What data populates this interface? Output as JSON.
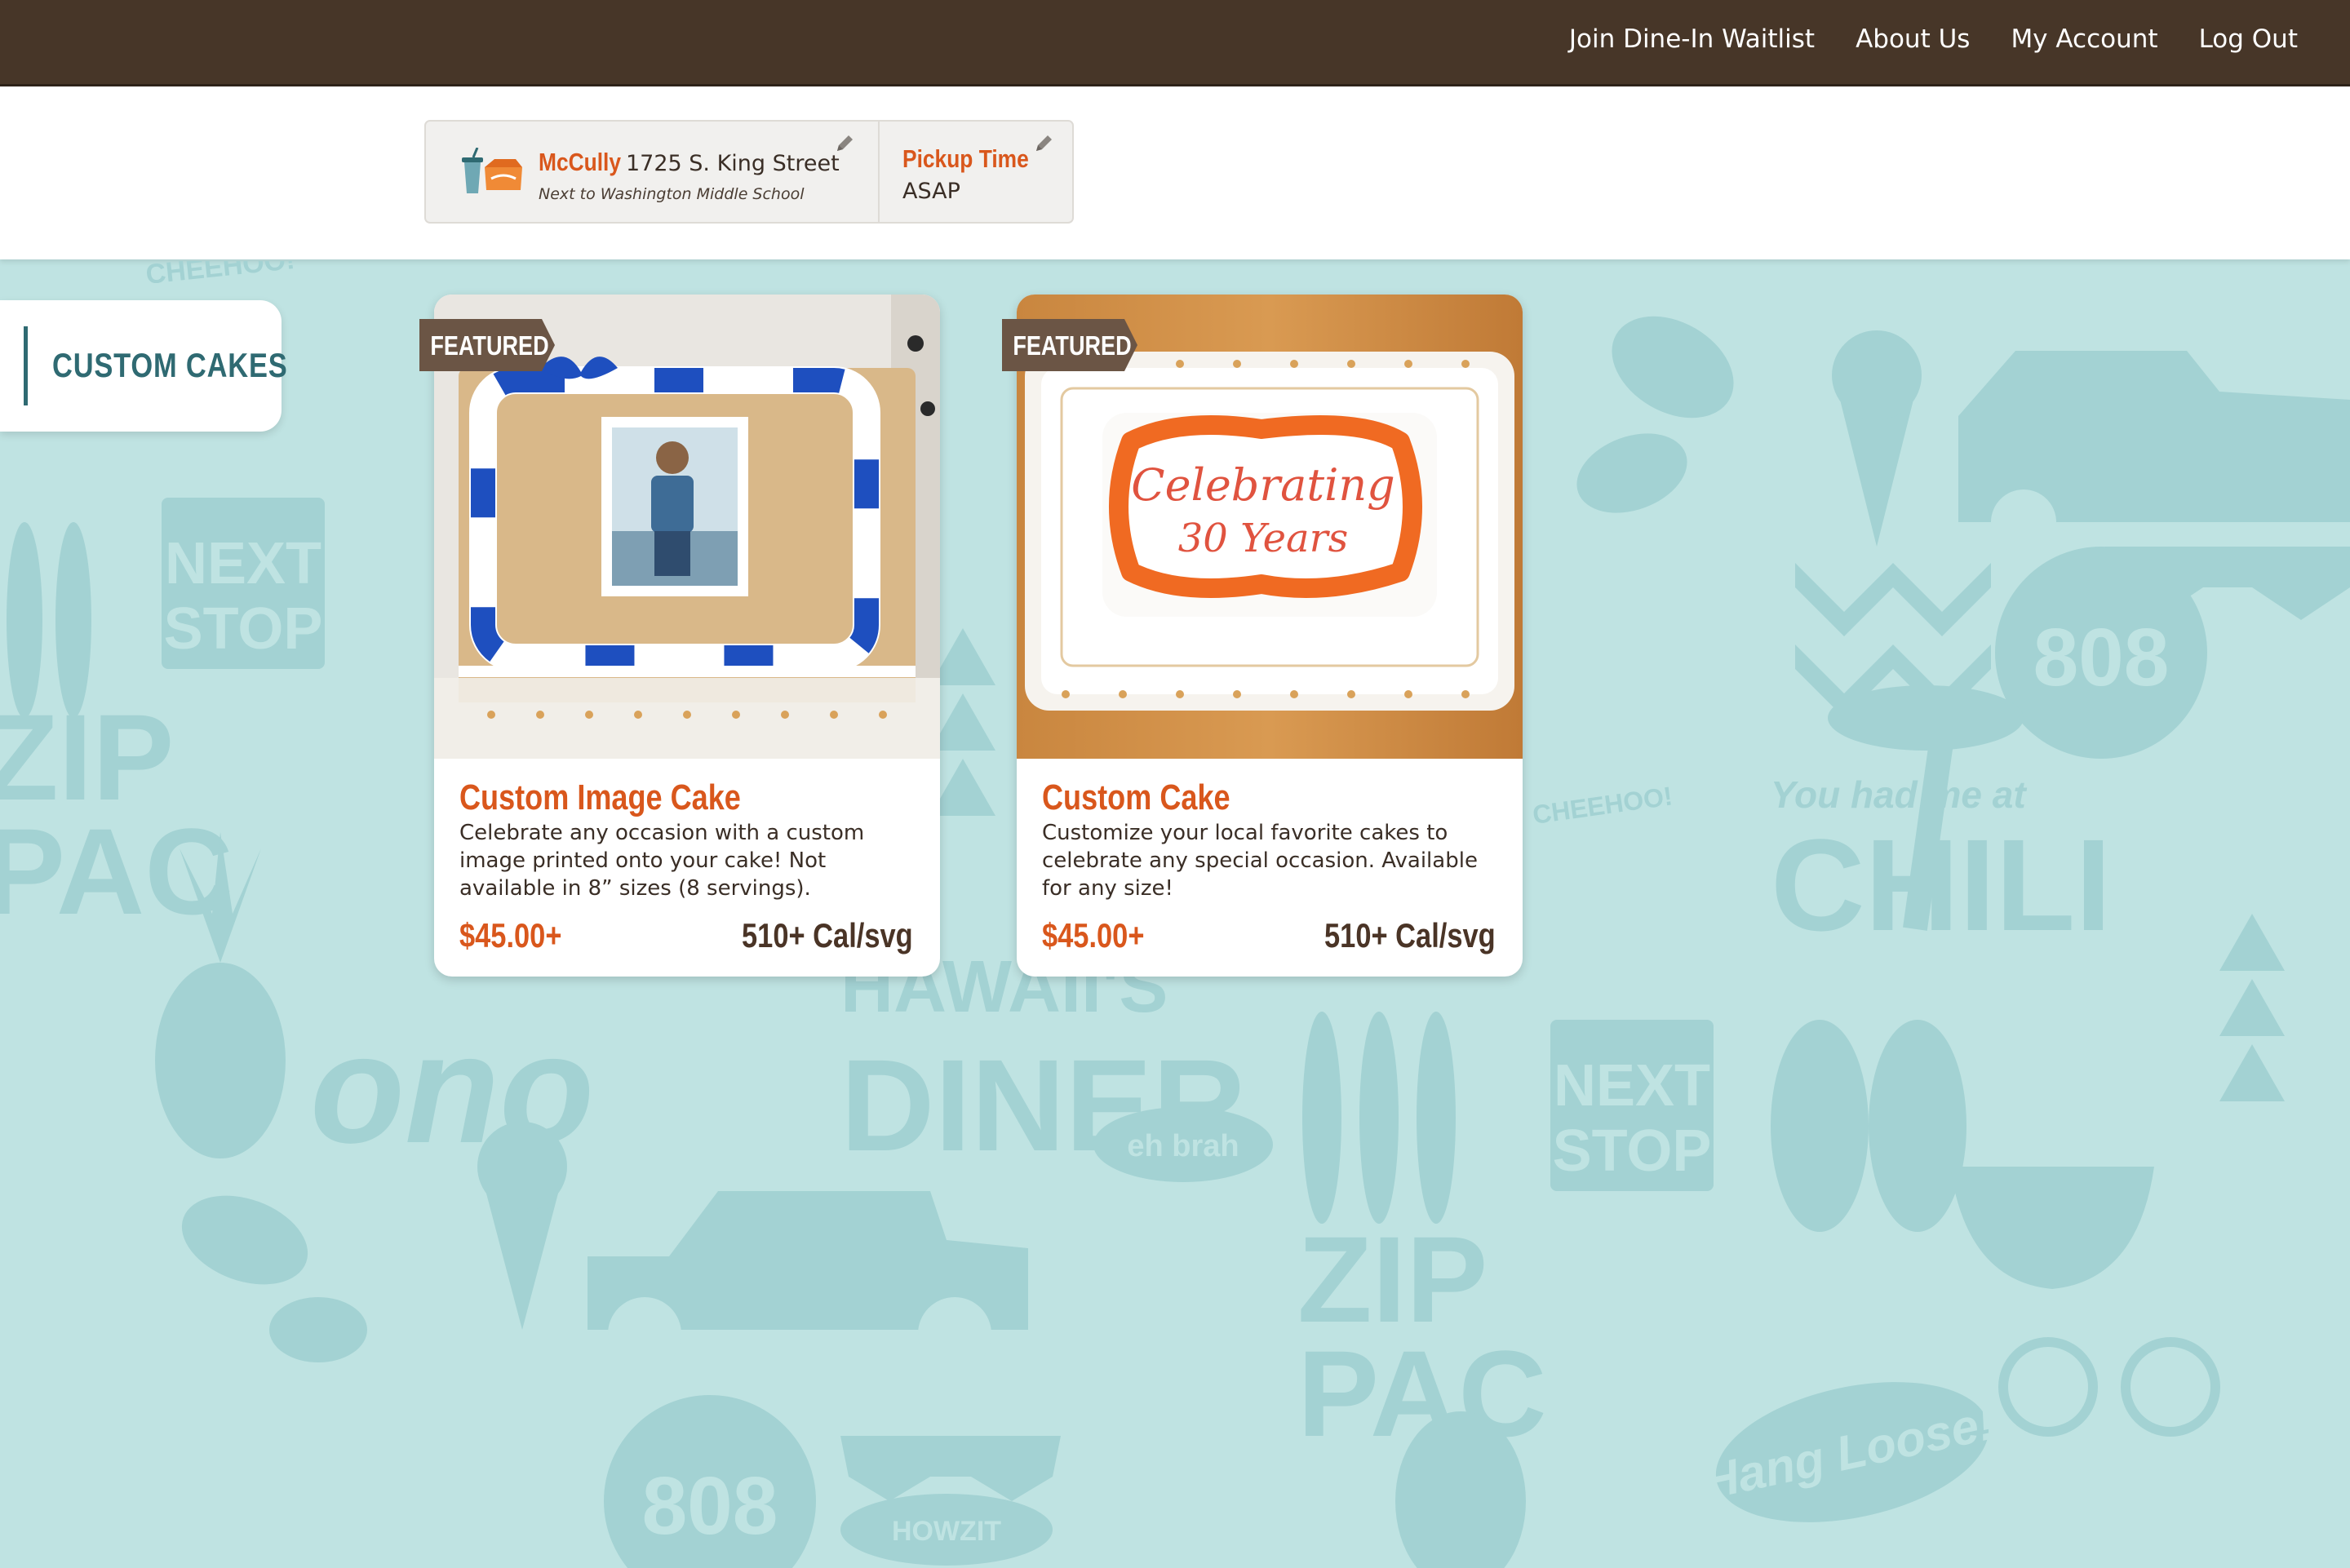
{
  "nav": {
    "items": [
      "Join Dine-In Waitlist",
      "About Us",
      "My Account",
      "Log Out"
    ]
  },
  "location": {
    "store_name": "McCully",
    "address": "1725 S. King Street",
    "note": "Next to Washington Middle School",
    "icons": [
      "drink-cup-icon",
      "food-box-icon",
      "pencil-icon"
    ]
  },
  "pickup": {
    "label": "Pickup Time",
    "value": "ASAP"
  },
  "category": {
    "label": "CUSTOM CAKES"
  },
  "products": [
    {
      "badge": "FEATURED",
      "title": "Custom Image Cake",
      "description": "Celebrate any occasion with a custom image printed onto your cake! Not available in 8” sizes (8 servings).",
      "price": "$45.00+",
      "calories": "510+ Cal/svg"
    },
    {
      "badge": "FEATURED",
      "title": "Custom Cake",
      "description": "Customize your local favorite cakes to celebrate any special occasion. Available for any size!",
      "price": "$45.00+",
      "calories": "510+ Cal/svg",
      "cake_text": [
        "Celebrating",
        "30 Years"
      ]
    }
  ],
  "background": {
    "pattern_words": [
      "NEXT",
      "STOP",
      "ZIP",
      "PAC",
      "ono",
      "HAWAII'S",
      "DINER",
      "CHILI",
      "You had me at",
      "808",
      "CHEEHOO!",
      "eh brah",
      "Hang Loose!",
      "HOWZIT"
    ]
  },
  "colors": {
    "topbar": "#473628",
    "accent_orange": "#d9571c",
    "teal_bg": "#bfe3e2",
    "pattern_teal": "#a3d2d3",
    "category_teal": "#2f6a72",
    "badge_brown": "#6b5545"
  }
}
